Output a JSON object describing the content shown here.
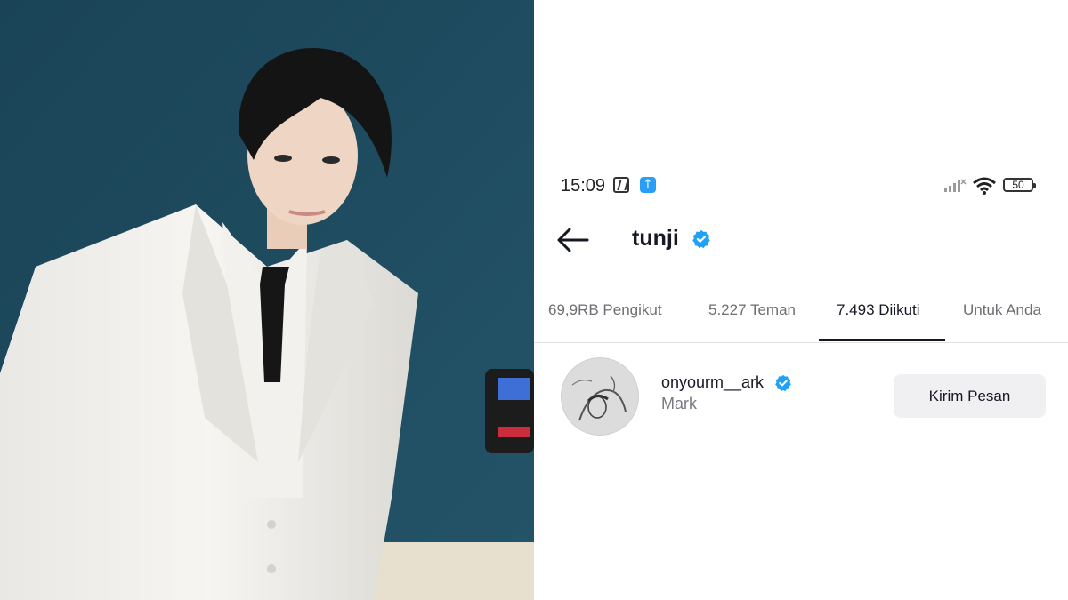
{
  "status_bar": {
    "time": "15:09",
    "icons": [
      "nfc-icon",
      "upload-icon",
      "signal-icon",
      "wifi-icon"
    ],
    "battery": "50"
  },
  "header": {
    "title": "tunji",
    "verified": true
  },
  "tabs": [
    {
      "label": "69,9RB Pengikut",
      "active": false
    },
    {
      "label": "5.227 Teman",
      "active": false
    },
    {
      "label": "7.493 Diikuti",
      "active": true
    },
    {
      "label": "Untuk Anda",
      "active": false
    }
  ],
  "following_list": [
    {
      "username": "onyourm__ark",
      "nickname": "Mark",
      "verified": true,
      "button_label": "Kirim Pesan"
    }
  ],
  "colors": {
    "verified_blue": "#20a1f5",
    "text_primary": "#161823",
    "text_secondary": "#7a7a80",
    "button_bg": "#f0f0f2"
  }
}
